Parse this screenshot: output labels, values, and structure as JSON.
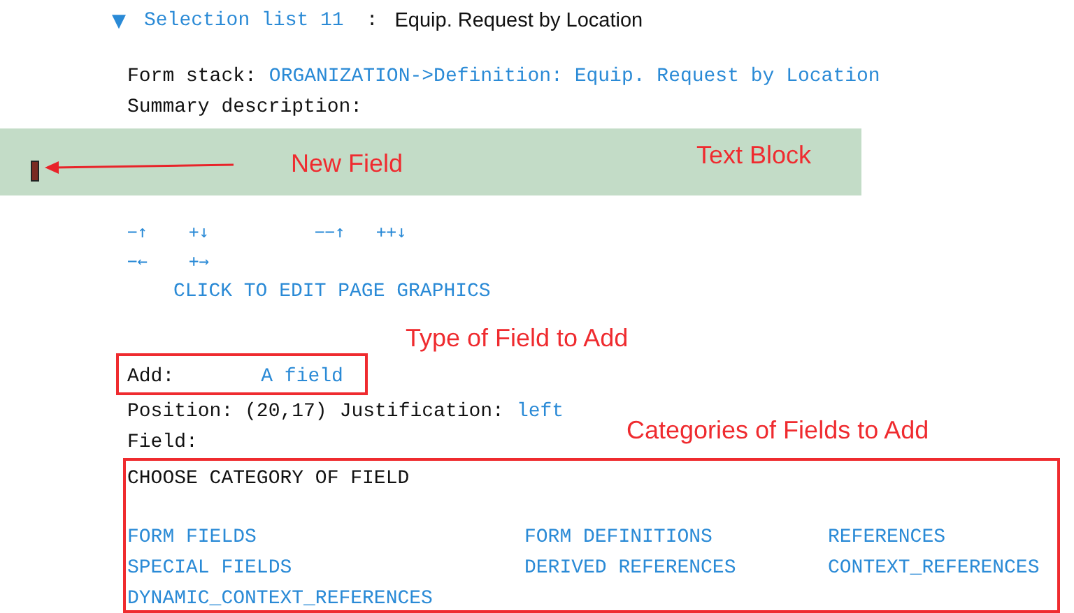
{
  "header": {
    "toggle": "▼",
    "expanded": true,
    "link": "Selection list 11",
    "separator": ":",
    "title": "Equip. Request by Location"
  },
  "form_stack": {
    "label": "Form stack:",
    "value": "ORGANIZATION->Definition: Equip. Request by Location"
  },
  "summary_label": "Summary description:",
  "text_block": {
    "label": "Text Block",
    "pointer_label": "New Field"
  },
  "move_controls": [
    [
      "−↑",
      "+↓",
      "−−↑",
      "++↓"
    ],
    [
      "−←",
      "+→"
    ]
  ],
  "edit_graphics": "CLICK TO EDIT PAGE GRAPHICS",
  "add_note": "Type of Field to Add",
  "add": {
    "label": "Add:",
    "value": "A field"
  },
  "position": {
    "label": "Position: (20,17)",
    "justification_label": "Justification:",
    "justification": "left"
  },
  "field_label": "Field:",
  "categories_note": "Categories of Fields to Add",
  "categories": {
    "title": "CHOOSE CATEGORY OF FIELD",
    "items": [
      [
        "FORM FIELDS",
        "FORM DEFINITIONS",
        "REFERENCES"
      ],
      [
        "SPECIAL FIELDS",
        "DERIVED REFERENCES",
        "CONTEXT_REFERENCES"
      ],
      [
        "DYNAMIC_CONTEXT_REFERENCES"
      ]
    ]
  }
}
